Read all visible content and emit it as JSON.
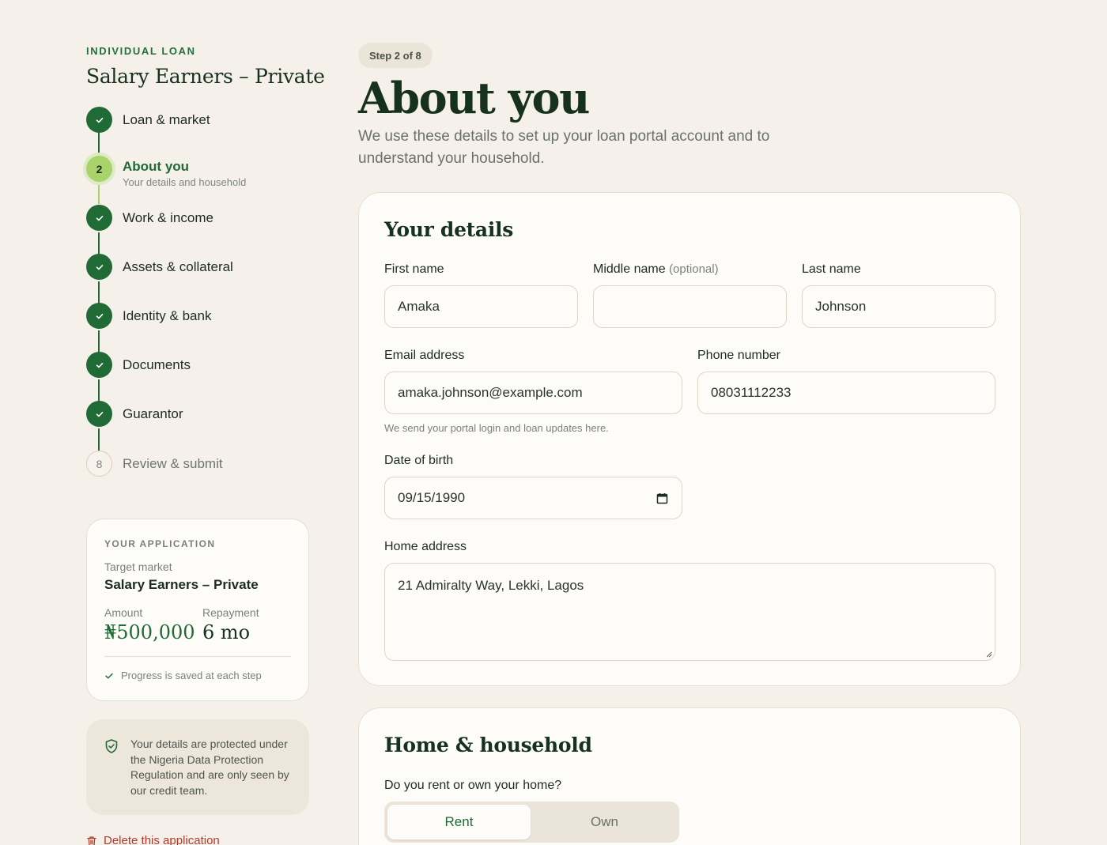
{
  "sidebar": {
    "eyebrow": "INDIVIDUAL LOAN",
    "product_title": "Salary Earners – Private",
    "steps": [
      {
        "label": "Loan & market",
        "state": "done"
      },
      {
        "label": "About you",
        "number": "2",
        "sub": "Your details and household",
        "state": "current"
      },
      {
        "label": "Work & income",
        "state": "done"
      },
      {
        "label": "Assets & collateral",
        "state": "done"
      },
      {
        "label": "Identity & bank",
        "state": "done"
      },
      {
        "label": "Documents",
        "state": "done"
      },
      {
        "label": "Guarantor",
        "state": "done"
      },
      {
        "label": "Review & submit",
        "number": "8",
        "state": "pending"
      }
    ],
    "application": {
      "eyebrow": "YOUR APPLICATION",
      "target_market_label": "Target market",
      "target_market_value": "Salary Earners – Private",
      "amount_label": "Amount",
      "amount_value": "₦500,000",
      "repayment_label": "Repayment",
      "repayment_value": "6 mo",
      "note": "Progress is saved at each step"
    },
    "privacy_text": "Your details are protected under the Nigeria Data Protection Regulation and are only seen by our credit team.",
    "delete_label": "Delete this application"
  },
  "main": {
    "step_pill": "Step 2 of 8",
    "title": "About you",
    "description": "We use these details to set up your loan portal account and to understand your household.",
    "details_card": {
      "title": "Your details",
      "first_name_label": "First name",
      "first_name_value": "Amaka",
      "middle_name_label": "Middle name",
      "middle_name_optional": "(optional)",
      "middle_name_value": "",
      "last_name_label": "Last name",
      "last_name_value": "Johnson",
      "email_label": "Email address",
      "email_value": "amaka.johnson@example.com",
      "email_hint": "We send your portal login and loan updates here.",
      "phone_label": "Phone number",
      "phone_value": "08031112233",
      "dob_label": "Date of birth",
      "dob_value": "09/15/1990",
      "address_label": "Home address",
      "address_value": "21 Admiralty Way, Lekki, Lagos"
    },
    "home_card": {
      "title": "Home & household",
      "question": "Do you rent or own your home?",
      "options": [
        "Rent",
        "Own"
      ],
      "selected": "Rent"
    }
  },
  "colors": {
    "accent": "#1f6a35",
    "current_step": "#a9d36a",
    "background": "#f5f1ea",
    "danger": "#b23a2c"
  }
}
